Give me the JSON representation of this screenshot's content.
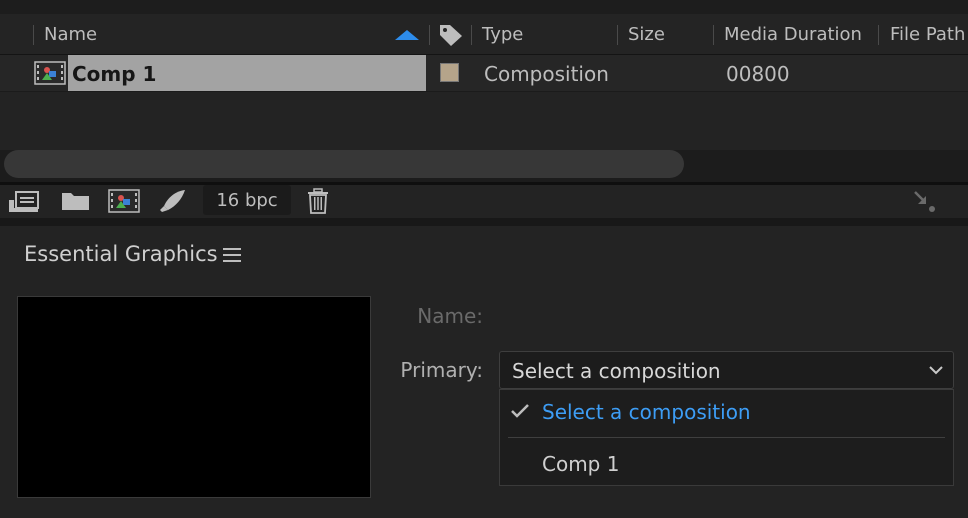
{
  "project_panel": {
    "columns": {
      "name": "Name",
      "type": "Type",
      "size": "Size",
      "media_duration": "Media Duration",
      "file_path": "File Path"
    },
    "sort": {
      "column": "Name",
      "direction": "ascending"
    },
    "items": [
      {
        "name": "Comp 1",
        "type": "Composition",
        "size": "",
        "media_duration": "00800",
        "label_color": "#b5a48a",
        "selected": true
      }
    ],
    "toolbar": {
      "icons": [
        "interpret-footage-icon",
        "new-folder-icon",
        "new-composition-icon",
        "render-queue-icon",
        "trash-icon"
      ],
      "bit_depth": "16 bpc"
    }
  },
  "essential_graphics": {
    "title": "Essential Graphics",
    "name_label": "Name:",
    "name_value": "",
    "primary_label": "Primary:",
    "primary_value": "Select a composition",
    "menu": {
      "items": [
        {
          "label": "Select a composition",
          "checked": true
        },
        {
          "label": "Comp 1",
          "checked": false
        }
      ]
    }
  },
  "colors": {
    "accent": "#2d8ceb",
    "background": "#232323",
    "selected_row": "#a3a3a3"
  }
}
